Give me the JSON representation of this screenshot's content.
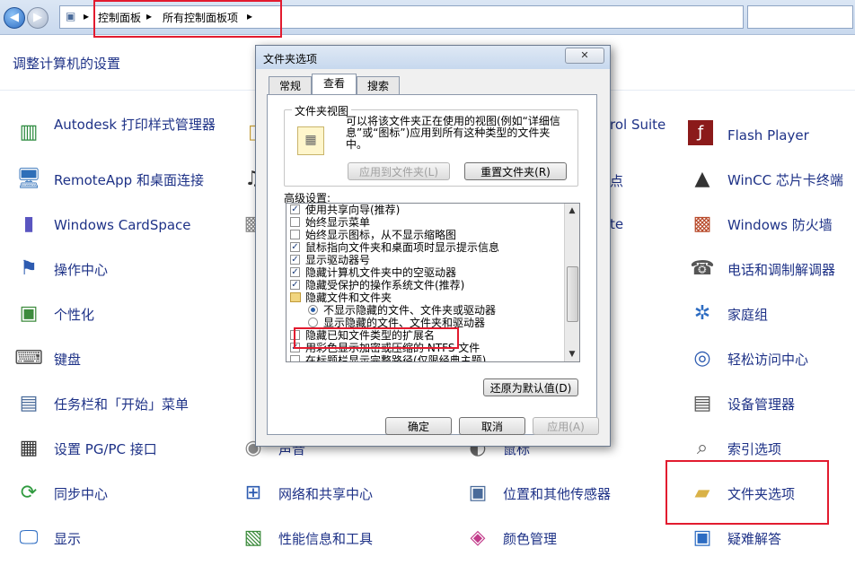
{
  "address": {
    "crumb1": "控制面板",
    "crumb2": "所有控制面板项",
    "sep": "▸"
  },
  "page_title": "调整计算机的设置",
  "items_col1": [
    {
      "label": "Autodesk 打印样式管理器",
      "icon": "printer-style-icon"
    },
    {
      "label": "RemoteApp 和桌面连接",
      "icon": "remote-desktop-icon"
    },
    {
      "label": "Windows CardSpace",
      "icon": "cardspace-icon"
    },
    {
      "label": "操作中心",
      "icon": "action-center-flag-icon"
    },
    {
      "label": "个性化",
      "icon": "personalization-icon"
    },
    {
      "label": "键盘",
      "icon": "keyboard-icon"
    },
    {
      "label": "任务栏和「开始」菜单",
      "icon": "taskbar-icon"
    },
    {
      "label": "设置 PG/PC 接口",
      "icon": "pgpc-interface-icon"
    },
    {
      "label": "同步中心",
      "icon": "sync-center-icon"
    },
    {
      "label": "显示",
      "icon": "display-icon"
    }
  ],
  "items_col2_partial": [
    {
      "label": "rol Suite"
    },
    {
      "label": "点"
    },
    {
      "label": "te"
    }
  ],
  "items_col2": [
    {
      "label": "声音",
      "icon": "sound-icon"
    },
    {
      "label": "网络和共享中心",
      "icon": "network-sharing-icon"
    },
    {
      "label": "性能信息和工具",
      "icon": "performance-icon"
    }
  ],
  "items_col3": [
    {
      "label": "鼠标",
      "icon": "mouse-icon"
    },
    {
      "label": "位置和其他传感器",
      "icon": "location-sensor-icon"
    },
    {
      "label": "颜色管理",
      "icon": "color-management-icon"
    }
  ],
  "items_col4": [
    {
      "label": "Flash Player",
      "icon": "flash-player-icon"
    },
    {
      "label": "WinCC 芯片卡终端",
      "icon": "wincc-card-icon"
    },
    {
      "label": "Windows 防火墙",
      "icon": "firewall-icon"
    },
    {
      "label": "电话和调制解调器",
      "icon": "phone-modem-icon"
    },
    {
      "label": "家庭组",
      "icon": "homegroup-icon"
    },
    {
      "label": "轻松访问中心",
      "icon": "ease-of-access-icon"
    },
    {
      "label": "设备管理器",
      "icon": "device-manager-icon"
    },
    {
      "label": "索引选项",
      "icon": "indexing-icon"
    },
    {
      "label": "文件夹选项",
      "icon": "folder-options-icon"
    },
    {
      "label": "疑难解答",
      "icon": "troubleshooting-icon"
    }
  ],
  "dialog": {
    "title": "文件夹选项",
    "close": "✕",
    "tabs": [
      "常规",
      "查看",
      "搜索"
    ],
    "folder_view": {
      "legend": "文件夹视图",
      "desc": "可以将该文件夹正在使用的视图(例如“详细信息”或“图标”)应用到所有这种类型的文件夹中。",
      "apply_btn": "应用到文件夹(L)",
      "reset_btn": "重置文件夹(R)"
    },
    "advanced_label": "高级设置:",
    "rows": [
      {
        "type": "check",
        "checked": true,
        "indent": 0,
        "label": "使用共享向导(推荐)"
      },
      {
        "type": "check",
        "checked": false,
        "indent": 0,
        "label": "始终显示菜单"
      },
      {
        "type": "check",
        "checked": false,
        "indent": 0,
        "label": "始终显示图标，从不显示缩略图"
      },
      {
        "type": "check",
        "checked": true,
        "indent": 0,
        "label": "鼠标指向文件夹和桌面项时显示提示信息"
      },
      {
        "type": "check",
        "checked": true,
        "indent": 0,
        "label": "显示驱动器号"
      },
      {
        "type": "check",
        "checked": true,
        "indent": 0,
        "label": "隐藏计算机文件夹中的空驱动器"
      },
      {
        "type": "check",
        "checked": true,
        "indent": 0,
        "label": "隐藏受保护的操作系统文件(推荐)"
      },
      {
        "type": "folder",
        "checked": false,
        "indent": 0,
        "label": "隐藏文件和文件夹"
      },
      {
        "type": "radio",
        "checked": true,
        "indent": 1,
        "label": "不显示隐藏的文件、文件夹或驱动器"
      },
      {
        "type": "radio",
        "checked": false,
        "indent": 1,
        "label": "显示隐藏的文件、文件夹和驱动器"
      },
      {
        "type": "check",
        "checked": false,
        "indent": 0,
        "label": "隐藏已知文件类型的扩展名"
      },
      {
        "type": "check",
        "checked": true,
        "indent": 0,
        "label": "用彩色显示加密或压缩的 NTFS 文件"
      },
      {
        "type": "check",
        "checked": false,
        "indent": 0,
        "label": "在标题栏显示完整路径(仅限经典主题)"
      }
    ],
    "restore_btn": "还原为默认值(D)",
    "ok_btn": "确定",
    "cancel_btn": "取消",
    "apply_btn": "应用(A)"
  }
}
